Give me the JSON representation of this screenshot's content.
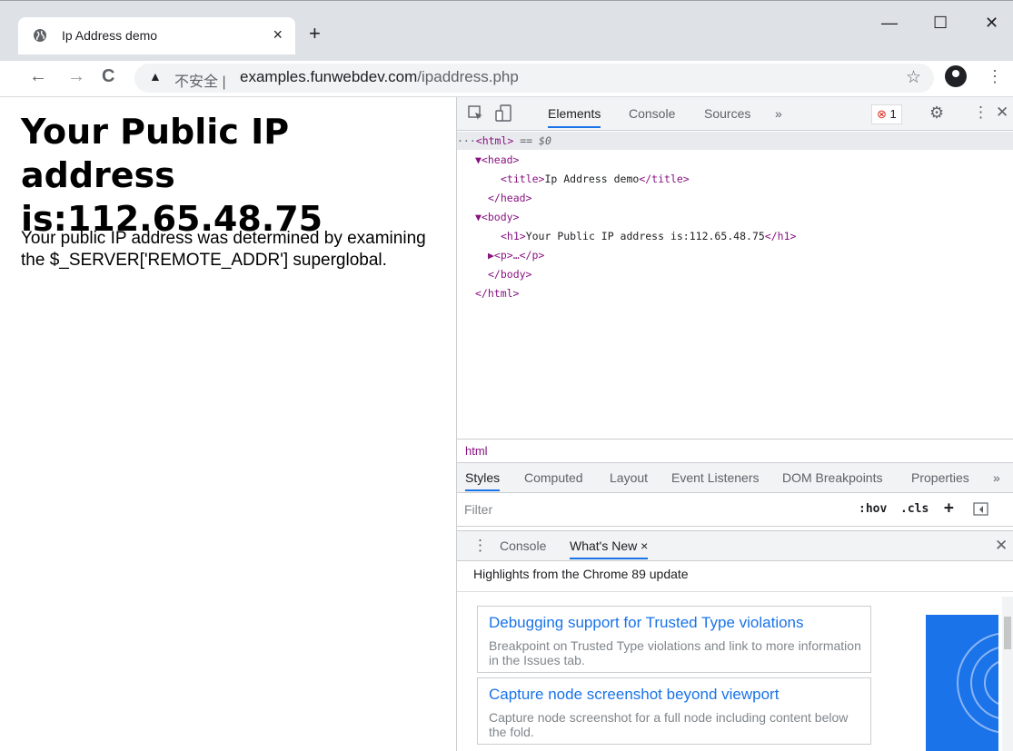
{
  "browser": {
    "tab_title": "Ip Address demo",
    "tab_close": "×",
    "new_tab": "+",
    "window_controls": {
      "minimize": "—",
      "maximize": "☐",
      "close": "✕"
    },
    "nav": {
      "back": "←",
      "forward": "→",
      "reload": "C"
    },
    "omnibox": {
      "warning_glyph": "▲",
      "insecure_label": "不安全 |",
      "url_host": "examples.funwebdev.com",
      "url_path": "/ipaddress.php",
      "star": "☆"
    },
    "menu_glyph": "⋮"
  },
  "page": {
    "heading": "Your Public IP address is:112.65.48.75",
    "paragraph": "Your public IP address was determined by examining the $_SERVER['REMOTE_ADDR'] superglobal."
  },
  "devtools": {
    "tabs": [
      "Elements",
      "Console",
      "Sources",
      "»"
    ],
    "error_count": "1",
    "dom_lines": [
      {
        "text": "<html>",
        "suffix": " == $0",
        "prefix": "···"
      },
      {
        "text": "▼<head>"
      },
      {
        "text": "<title>",
        "inner": "Ip Address demo",
        "close": "</title>"
      },
      {
        "text": "</head>"
      },
      {
        "text": "▼<body>"
      },
      {
        "text": "<h1>",
        "inner": "Your Public IP address is:112.65.48.75",
        "close": "</h1>"
      },
      {
        "text": "▶<p>…</p>"
      },
      {
        "text": "</body>"
      },
      {
        "text": "</html>"
      }
    ],
    "breadcrumb": "html",
    "subtabs": [
      "Styles",
      "Computed",
      "Layout",
      "Event Listeners",
      "DOM Breakpoints",
      "Properties",
      "»"
    ],
    "filter_placeholder": "Filter",
    "filter_buttons": [
      ":hov",
      ".cls",
      "+"
    ],
    "drawer": {
      "tabs": [
        "Console",
        "What's New"
      ],
      "close_tab": "×",
      "highlights": "Highlights from the Chrome 89 update",
      "cards": [
        {
          "title": "Debugging support for Trusted Type violations",
          "desc": "Breakpoint on Trusted Type violations and link to more information in the Issues tab."
        },
        {
          "title": "Capture node screenshot beyond viewport",
          "desc": "Capture node screenshot for a full node including content below the fold."
        }
      ]
    }
  }
}
